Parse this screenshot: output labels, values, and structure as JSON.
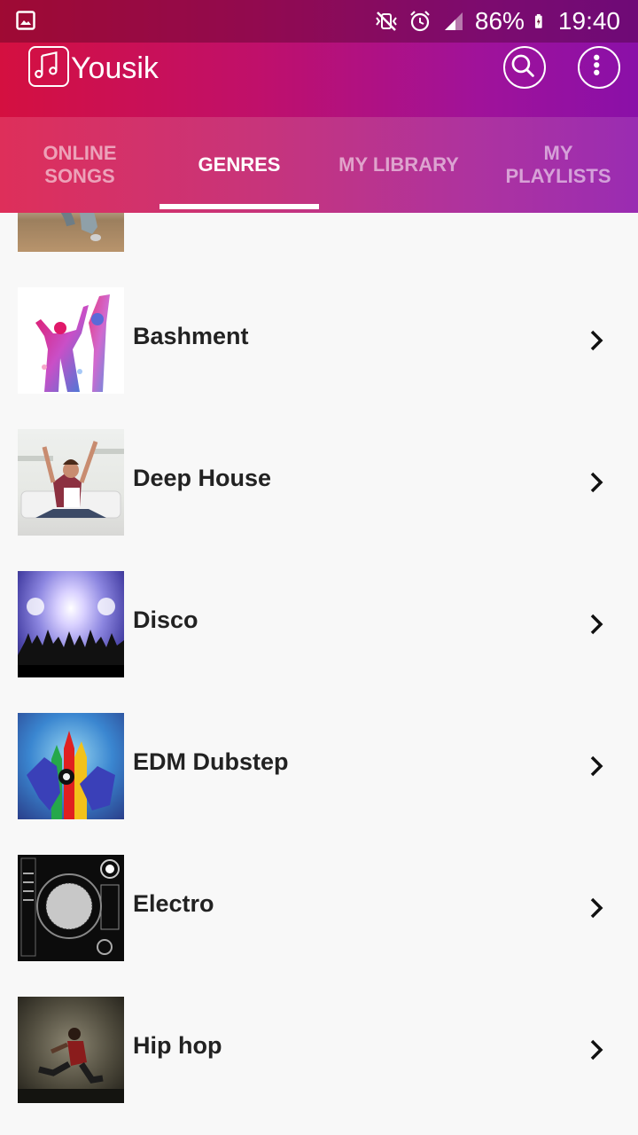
{
  "status_bar": {
    "battery": "86%",
    "time": "19:40"
  },
  "app": {
    "title": "Yousik"
  },
  "tabs": [
    {
      "label": "ONLINE SONGS",
      "active": false
    },
    {
      "label": "GENRES",
      "active": true
    },
    {
      "label": "MY LIBRARY",
      "active": false
    },
    {
      "label": "MY PLAYLISTS",
      "active": false
    }
  ],
  "genres": [
    {
      "name": "Bashment"
    },
    {
      "name": "Deep House"
    },
    {
      "name": "Disco"
    },
    {
      "name": "EDM Dubstep"
    },
    {
      "name": "Electro"
    },
    {
      "name": "Hip hop"
    }
  ],
  "colors": {
    "accent_start": "#d41040",
    "accent_end": "#8a10a8",
    "list_background": "#f8f8f8",
    "text": "#222222"
  }
}
